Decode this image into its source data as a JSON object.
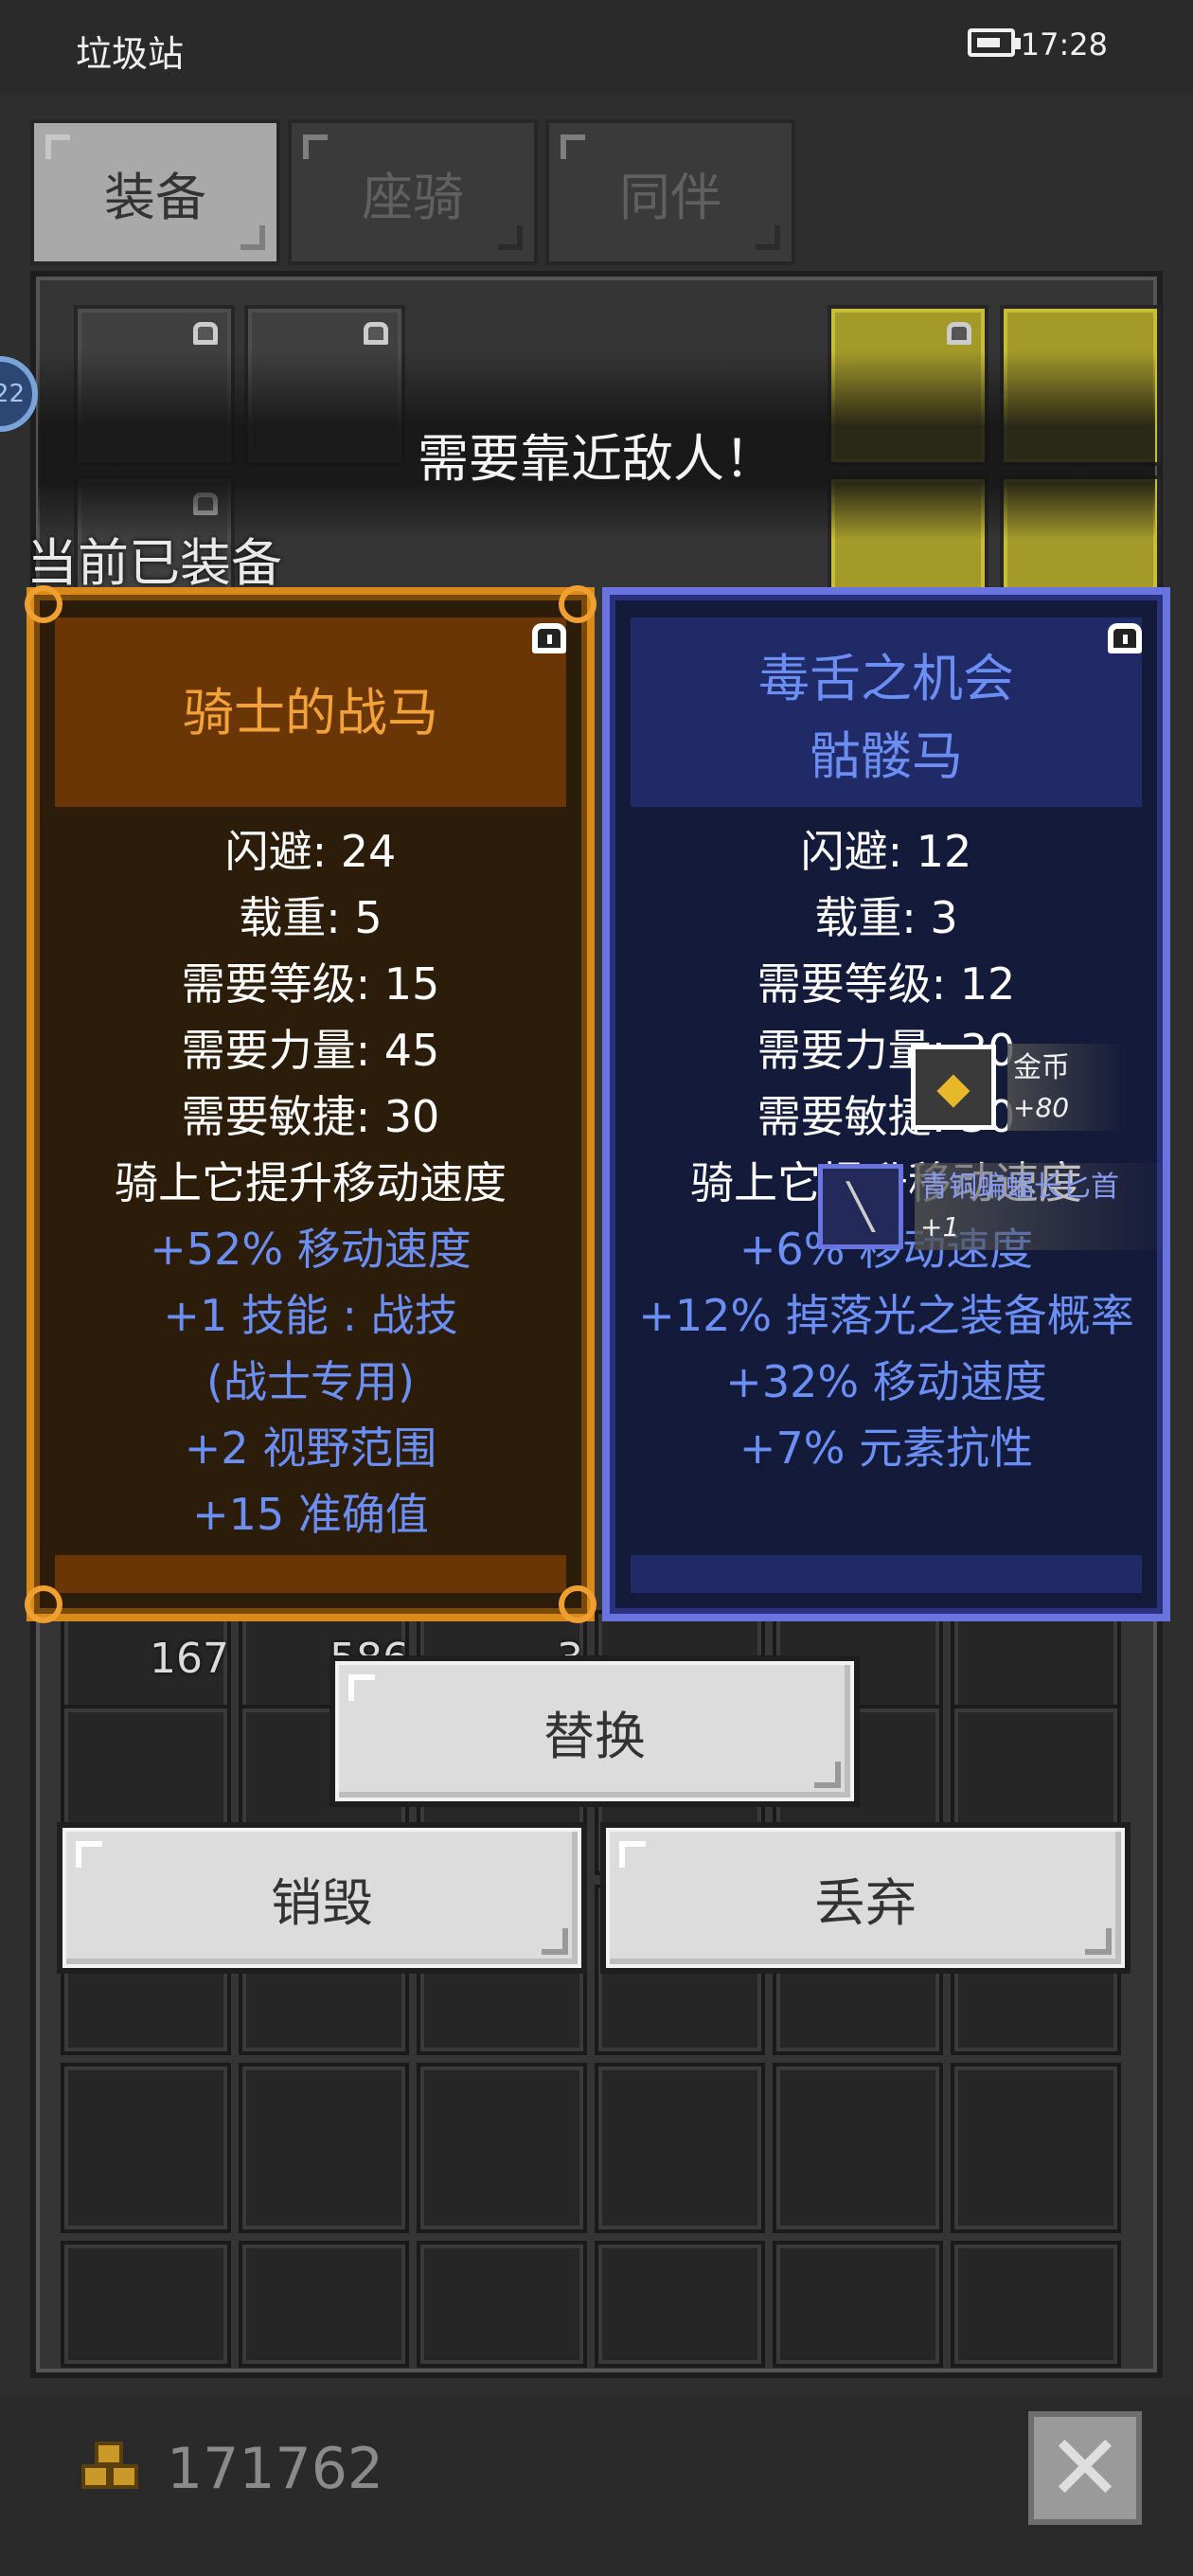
{
  "status_bar": {
    "title": "垃圾站",
    "time": "17:28"
  },
  "tabs": [
    {
      "label": "装备",
      "active": true
    },
    {
      "label": "座骑",
      "active": false
    },
    {
      "label": "同伴",
      "active": false
    }
  ],
  "avatar_badge": "22",
  "toast": "需要靠近敌人！",
  "equipped_label": "当前已装备",
  "current_item": {
    "name": "骑士的战马",
    "stats": [
      "闪避: 24",
      "载重: 5",
      "需要等级: 15",
      "需要力量: 45",
      "需要敏捷: 30",
      "骑上它提升移动速度"
    ],
    "bonuses": [
      "+52% 移动速度",
      "+1 技能 : 战技",
      "(战士专用)",
      "+2 视野范围",
      "+15 准确值"
    ]
  },
  "new_item": {
    "name_line1": "毒舌之机会",
    "name_line2": "骷髅马",
    "stats": [
      "闪避: 12",
      "载重: 3",
      "需要等级: 12",
      "需要力量: 30",
      "需要敏捷: 30",
      "骑上它提升移动速度"
    ],
    "bonuses": [
      "+6% 移动速度",
      "+12% 掉落光之装备概率",
      "+32% 移动速度",
      "+7% 元素抗性"
    ]
  },
  "loot_popups": [
    {
      "name": "金币",
      "amount": "+80",
      "icon": "gold-coins-icon"
    },
    {
      "name": "青铜蝙蝠长匕首",
      "amount": "+1",
      "icon": "dagger-icon"
    }
  ],
  "inventory_counts": [
    "167",
    "586",
    "3"
  ],
  "buttons": {
    "replace": "替换",
    "destroy": "销毁",
    "discard": "丢弃"
  },
  "gold_total": "171762",
  "colors": {
    "orange_border": "#d98a1a",
    "orange_name": "#f3a239",
    "blue_border": "#6a74e0",
    "blue_text": "#6b8ff5"
  }
}
